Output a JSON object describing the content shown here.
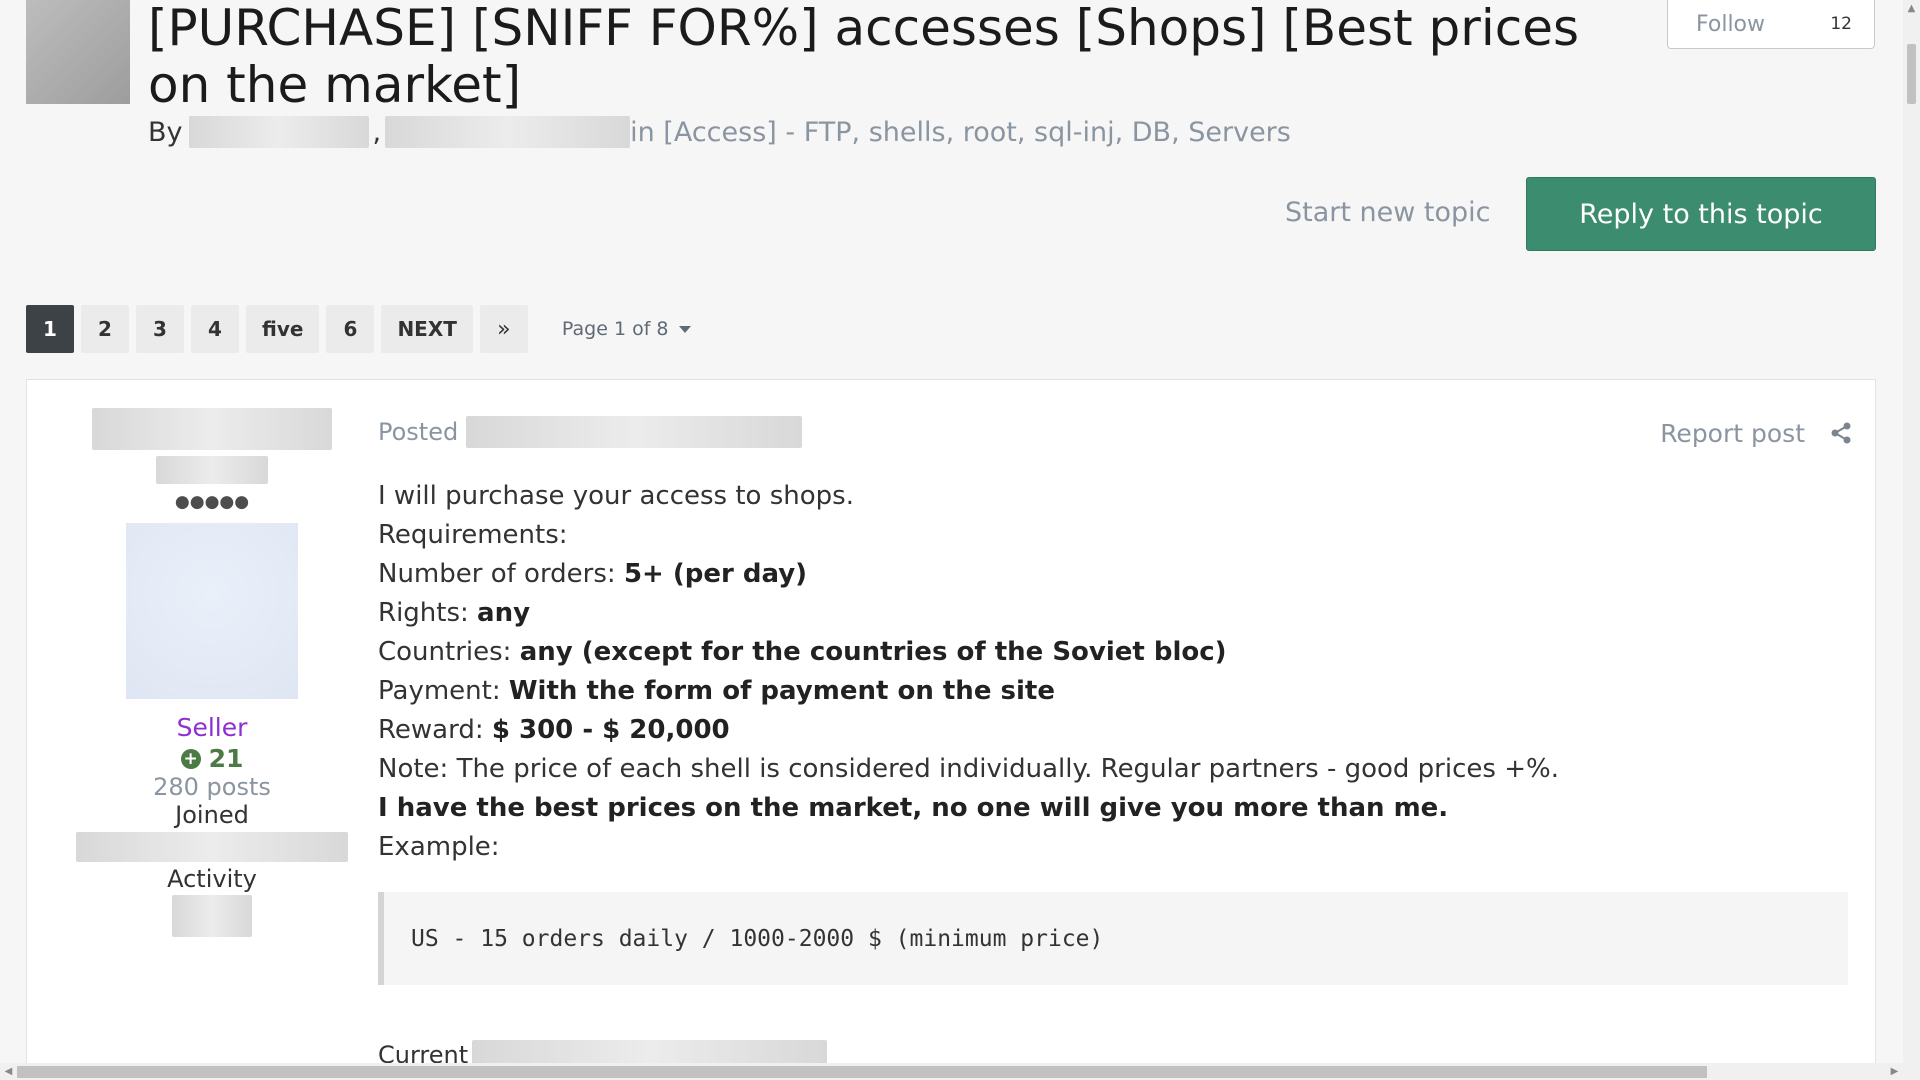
{
  "topic": {
    "title": "[PURCHASE] [SNIFF FOR%] accesses [Shops] [Best prices on the market]",
    "by_label": "By",
    "comma": ",",
    "forum_text": "in [Access] - FTP, shells, root, sql-inj, DB, Servers"
  },
  "follow": {
    "label": "Follow",
    "count": "12"
  },
  "actions": {
    "start_new_topic": "Start new topic",
    "reply": "Reply to this topic"
  },
  "pagination": {
    "pages": [
      "1",
      "2",
      "3",
      "4",
      "five",
      "6"
    ],
    "next": "NEXT",
    "last": "»",
    "page_info": "Page 1 of 8"
  },
  "author": {
    "pips": "●●●●●",
    "group": "Seller",
    "reputation": "21",
    "posts": "280 posts",
    "joined_label": "Joined",
    "activity_label": "Activity"
  },
  "post": {
    "posted_label": "Posted",
    "report": "Report post",
    "lines": [
      {
        "text": "I will purchase your access to shops.",
        "bold": ""
      },
      {
        "text": "Requirements:",
        "bold": ""
      },
      {
        "text": "Number of orders: ",
        "bold": "5+ (per day)"
      },
      {
        "text": "Rights: ",
        "bold": "any"
      },
      {
        "text": "Countries: ",
        "bold": "any (except for the countries of the Soviet bloc)"
      },
      {
        "text": "Payment: ",
        "bold": "With the form of payment on the site"
      },
      {
        "text": "Reward: ",
        "bold": "$ 300 - $ 20,000"
      },
      {
        "text": "Note: The price of each shell is considered individually. Regular partners - good prices +%.",
        "bold": ""
      },
      {
        "text": "",
        "bold": "I have the best prices on the market, no one will give you more than me."
      },
      {
        "text": "Example:",
        "bold": ""
      }
    ],
    "code": "US - 15 orders daily / 1000-2000 $ (minimum price)",
    "current_label": "Current"
  },
  "icons": {
    "share": "share-icon",
    "plus": "plus-circle-icon",
    "caret": "caret-down-icon"
  },
  "colors": {
    "reply_button": "#3c8d6f",
    "active_page": "#3d4246",
    "seller_group": "#8e2fd0",
    "reputation": "#4c7a44"
  }
}
